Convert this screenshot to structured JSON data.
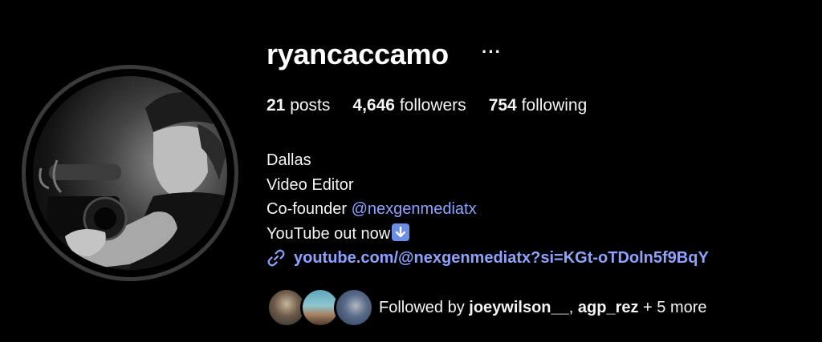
{
  "profile": {
    "username": "ryancaccamo",
    "more_label": "···"
  },
  "stats": {
    "posts_count": "21",
    "posts_label": "posts",
    "followers_count": "4,646",
    "followers_label": "followers",
    "following_count": "754",
    "following_label": "following"
  },
  "bio": {
    "line1": "Dallas",
    "line2": "Video Editor",
    "line3_prefix": "Co-founder ",
    "line3_mention": "@nexgenmediatx",
    "line4": "YouTube out now"
  },
  "link": {
    "icon": "link-icon",
    "text": "youtube.com/@nexgenmediatx?si=KGt-oTDoln5f9BqY"
  },
  "followed_by": {
    "prefix": "Followed by ",
    "user1": "joeywilson__",
    "separator": ", ",
    "user2": "agp_rez",
    "suffix": " + 5 more"
  },
  "colors": {
    "background": "#000000",
    "text": "#f5f5f5",
    "link": "#8ea3ff",
    "avatar_ring": "#3a3a3a"
  }
}
